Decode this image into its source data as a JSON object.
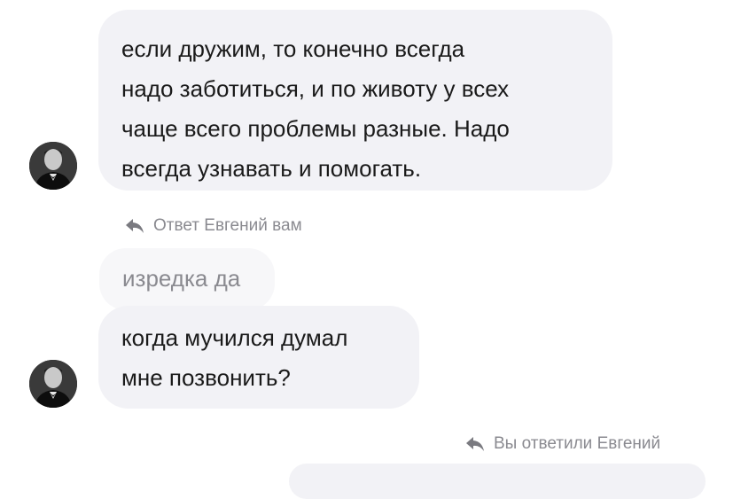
{
  "messages": [
    {
      "text": "если дружим, то конечно всегда\nнадо заботиться, и по животу у всех\nчаще всего проблемы разные. Надо\nвсегда узнавать и помогать."
    },
    {
      "quoted": "изредка да",
      "text": "когда мучился думал\nмне позвонить?"
    }
  ],
  "reply_labels": {
    "incoming": "Ответ Евгений вам",
    "outgoing": "Вы ответили Евгений"
  },
  "icons": {
    "reply": "reply-arrow-icon",
    "avatar": "avatar-man-in-tuxedo"
  },
  "colors": {
    "bubble": "#f2f2f6",
    "muted_text": "#8a8a90"
  }
}
